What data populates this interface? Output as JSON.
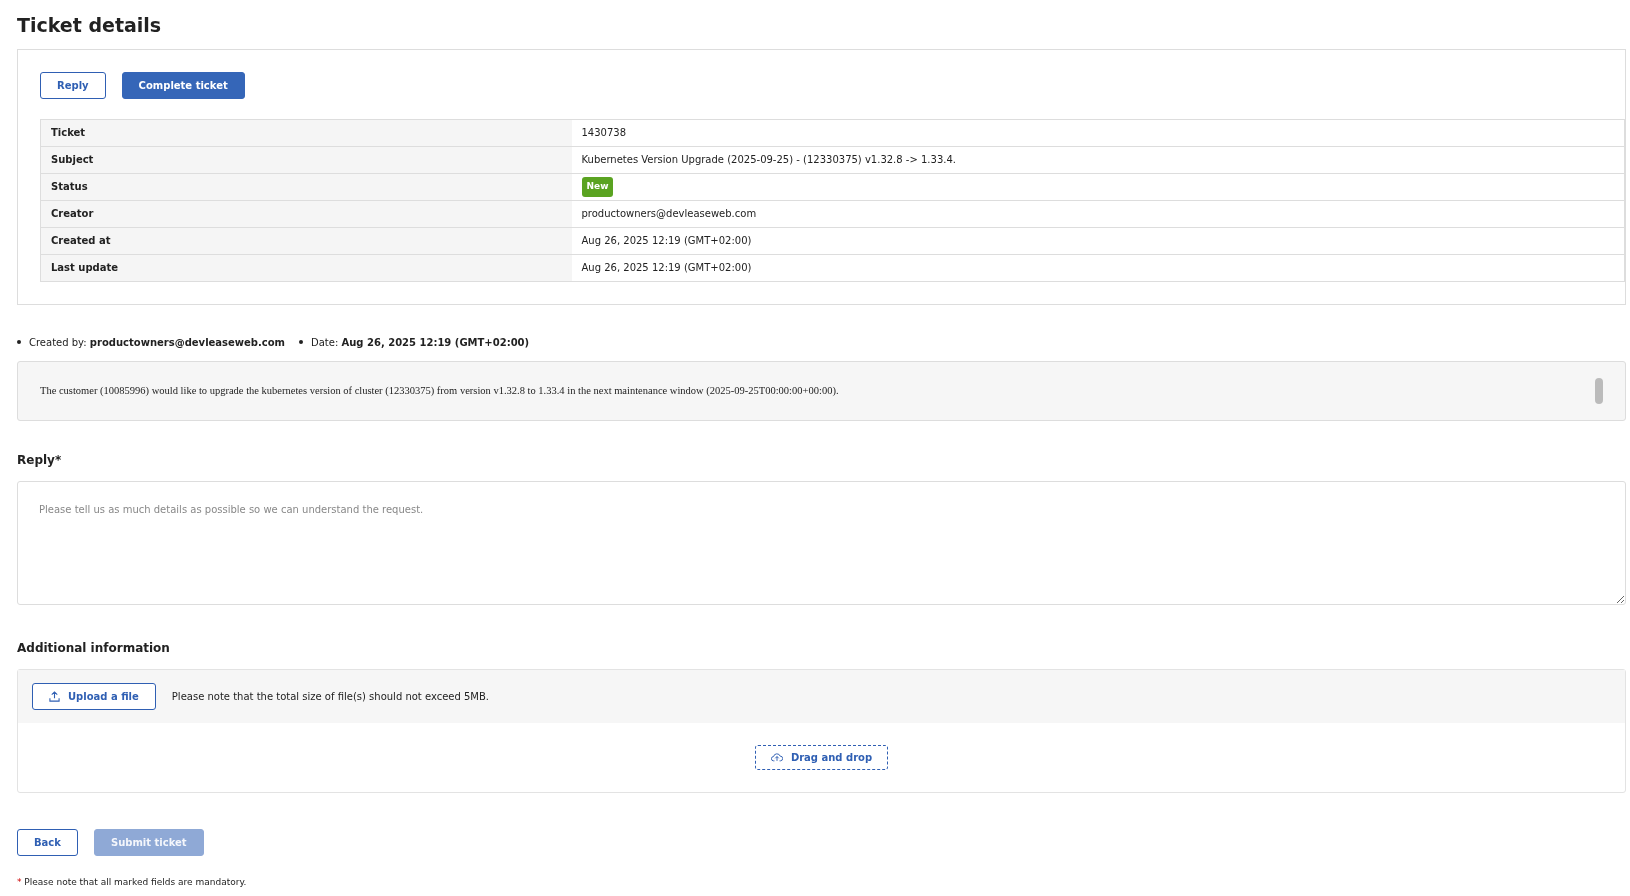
{
  "page_title": "Ticket details",
  "actions": [
    {
      "label": "Reply",
      "kind": "outline"
    },
    {
      "label": "Complete ticket",
      "kind": "primary"
    }
  ],
  "details": [
    {
      "label": "Ticket",
      "value": "1430738",
      "kind": "text"
    },
    {
      "label": "Subject",
      "value": "Kubernetes Version Upgrade (2025-09-25) - (12330375) v1.32.8 -> 1.33.4.",
      "kind": "text"
    },
    {
      "label": "Status",
      "value": "New",
      "kind": "badge"
    },
    {
      "label": "Creator",
      "value": "productowners@devleaseweb.com",
      "kind": "text"
    },
    {
      "label": "Created at",
      "value": "Aug 26, 2025 12:19 (GMT+02:00)",
      "kind": "text"
    },
    {
      "label": "Last update",
      "value": "Aug 26, 2025 12:19 (GMT+02:00)",
      "kind": "text"
    }
  ],
  "meta": [
    "Created by: **productowners@devleaseweb.com**",
    "Date: **Aug 26, 2025 12:19 (GMT+02:00)**"
  ],
  "message": "The customer (10085996) would like to upgrade the kubernetes version of cluster (12330375) from version v1.32.8 to 1.33.4 in the next maintenance window (2025-09-25T00:00:00+00:00).",
  "reply": {
    "label": "Reply",
    "required_mark": "*",
    "placeholder": "Please tell us as much details as possible so we can understand the request."
  },
  "additional": {
    "title": "Additional information",
    "upload_label": "Upload a file",
    "note": "Please note that the total size of file(s) should not exceed 5MB.",
    "drop_label": "Drag and drop"
  },
  "footer_buttons": [
    {
      "label": "Back",
      "kind": "outline",
      "disabled": false
    },
    {
      "label": "Submit ticket",
      "kind": "primary",
      "disabled": true
    }
  ],
  "footnote": {
    "mark": "*",
    "text": "Please note that all marked fields are mandatory."
  }
}
